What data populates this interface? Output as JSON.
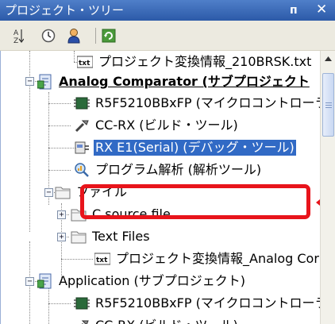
{
  "window": {
    "title": "プロジェクト・ツリー",
    "pin_label": "ᴨ",
    "close_label": "✕"
  },
  "toolbar": {
    "icons": [
      "sort-icon",
      "clock-icon",
      "user-icon",
      "refresh-icon"
    ]
  },
  "tree": {
    "items": [
      {
        "label": "プロジェクト変換情報_210BRSK.txt",
        "icon": "txt-file-icon"
      },
      {
        "label": "Analog Comparator (サブプロジェクト",
        "icon": "project-icon"
      },
      {
        "label": "R5F5210BBxFP (マイクロコントローラ",
        "icon": "chip-icon"
      },
      {
        "label": "CC-RX (ビルド・ツール)",
        "icon": "build-tool-icon"
      },
      {
        "label": "RX E1(Serial) (デバッグ・ツール)",
        "icon": "debug-tool-icon"
      },
      {
        "label": "プログラム解析 (解析ツール)",
        "icon": "analysis-tool-icon"
      },
      {
        "label": "ファイル",
        "icon": "folder-icon"
      },
      {
        "label": "C source file",
        "icon": "folder-icon"
      },
      {
        "label": "Text Files",
        "icon": "folder-icon"
      },
      {
        "label": "プロジェクト変換情報_Analog Cor",
        "icon": "txt-file-icon"
      },
      {
        "label": "Application (サブプロジェクト)",
        "icon": "project-icon"
      },
      {
        "label": "R5F5210BBxFP (マイクロコントローラ",
        "icon": "chip-icon"
      },
      {
        "label": "CC-RX (ビルド・ツール)",
        "icon": "build-tool-icon"
      }
    ],
    "expand_plus": "+",
    "expand_minus": "−"
  },
  "colors": {
    "selection": "#316ac5",
    "highlight": "#e8141b",
    "title_bar": "#2c5aa8"
  }
}
